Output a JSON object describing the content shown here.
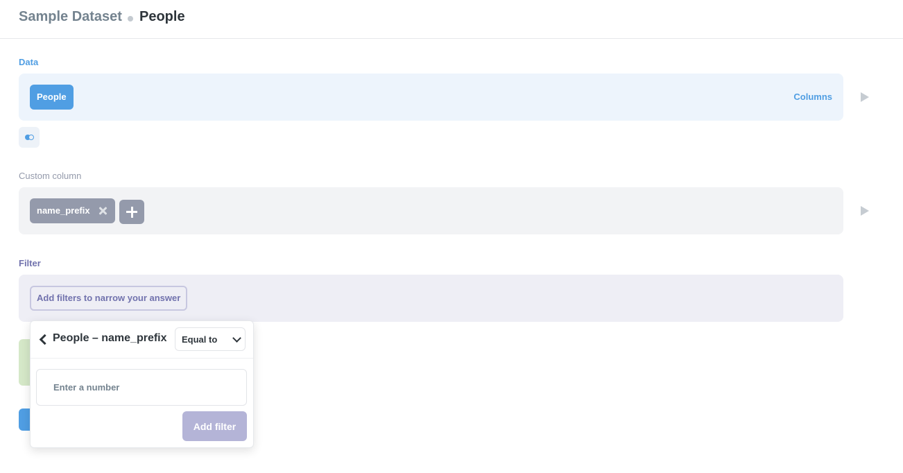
{
  "header": {
    "database": "Sample Dataset",
    "table": "People"
  },
  "data_section": {
    "label": "Data",
    "table_pill": "People",
    "columns_link": "Columns"
  },
  "custom_column_section": {
    "label": "Custom column",
    "expression_name": "name_prefix"
  },
  "filter_section": {
    "label": "Filter",
    "add_filters_text": "Add filters to narrow your answer"
  },
  "filter_popover": {
    "title": "People – name_prefix",
    "operator": "Equal to",
    "input_placeholder": "Enter a number",
    "add_button": "Add filter"
  },
  "colors": {
    "data_accent": "#509ee3",
    "custom_accent": "#949aab",
    "filter_accent": "#7172ad",
    "summarize_stub": "#d5e8c8"
  },
  "icons": [
    "play-icon",
    "toggle-icon",
    "close-icon",
    "plus-icon",
    "chevron-left-icon",
    "chevron-down-icon"
  ]
}
